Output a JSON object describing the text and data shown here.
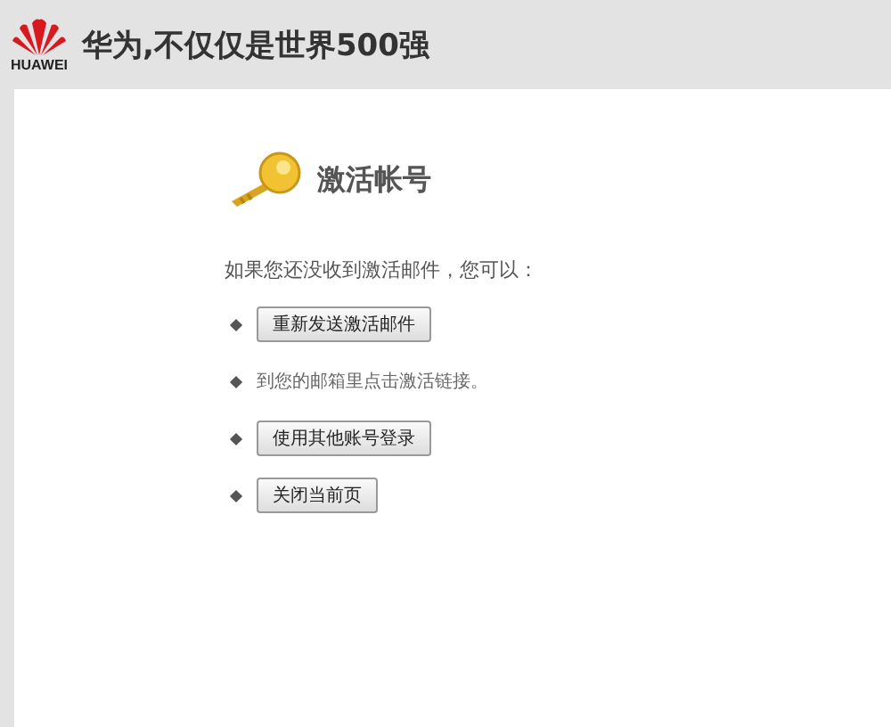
{
  "header": {
    "logo_text": "HUAWEI",
    "title": "华为,不仅仅是世界500强"
  },
  "panel": {
    "heading": "激活帐号",
    "intro": "如果您还没收到激活邮件，您可以：",
    "options": [
      {
        "kind": "button",
        "label": "重新发送激活邮件"
      },
      {
        "kind": "text",
        "label": "到您的邮箱里点击激活链接。"
      },
      {
        "kind": "button",
        "label": "使用其他账号登录"
      },
      {
        "kind": "button",
        "label": "关闭当前页"
      }
    ]
  }
}
